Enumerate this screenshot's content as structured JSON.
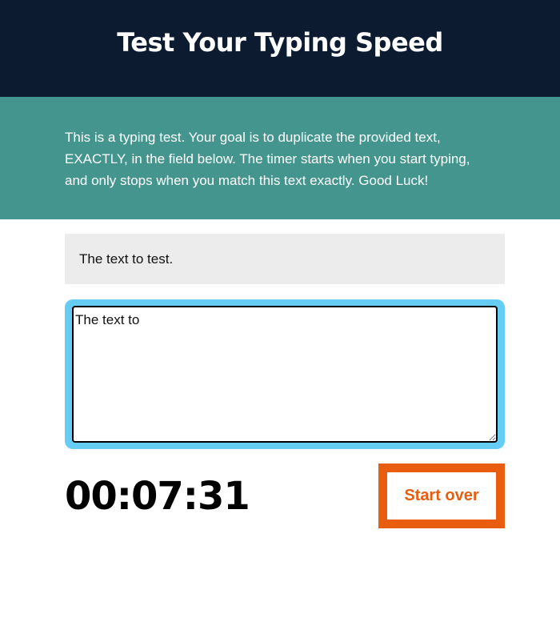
{
  "header": {
    "title": "Test Your Typing Speed"
  },
  "intro": {
    "text": "This is a typing test. Your goal is to duplicate the provided text, EXACTLY, in the field below. The timer starts when you start typing, and only stops when you match this text exactly. Good Luck!"
  },
  "test": {
    "origin_text": "The text to test.",
    "input_value": "The text to"
  },
  "timer": {
    "value": "00:07:31"
  },
  "controls": {
    "reset_label": "Start over"
  },
  "colors": {
    "header_bg": "#0c1b30",
    "intro_bg": "#43958e",
    "origin_bg": "#ececec",
    "focus_ring": "#65ccf3",
    "accent": "#e95d0f"
  }
}
